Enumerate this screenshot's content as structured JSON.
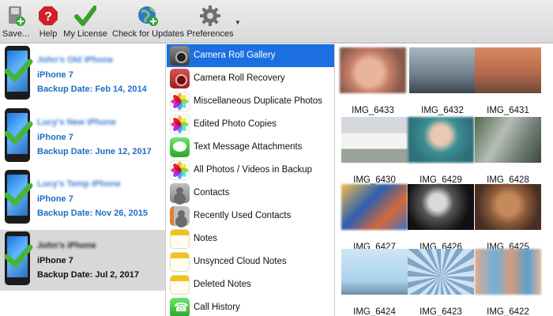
{
  "toolbar": {
    "items": [
      {
        "label": "Save...",
        "icon": "save-icon"
      },
      {
        "label": "Help",
        "icon": "help-icon"
      },
      {
        "label": "My License",
        "icon": "checkmark-icon"
      },
      {
        "label": "Check for Updates",
        "icon": "globe-update-icon"
      },
      {
        "label": "Preferences",
        "icon": "gear-icon"
      }
    ]
  },
  "devices": [
    {
      "name": "John's Old iPhone",
      "model": "iPhone 7",
      "backup": "Backup Date: Feb 14, 2014",
      "selected": false
    },
    {
      "name": "Lucy's New iPhone",
      "model": "iPhone 7",
      "backup": "Backup Date: June 12, 2017",
      "selected": false
    },
    {
      "name": "Lucy's Temp iPhone",
      "model": "iPhone 7",
      "backup": "Backup Date: Nov 26, 2015",
      "selected": false
    },
    {
      "name": "John's iPhone",
      "model": "iPhone 7",
      "backup": "Backup Date: Jul 2, 2017",
      "selected": true
    }
  ],
  "categories": [
    {
      "label": "Camera Roll Gallery",
      "icon": "camera-icon",
      "selected": true
    },
    {
      "label": "Camera Roll Recovery",
      "icon": "camera-red-icon",
      "selected": false
    },
    {
      "label": "Miscellaneous Duplicate Photos",
      "icon": "photos-icon",
      "selected": false
    },
    {
      "label": "Edited Photo Copies",
      "icon": "photos-icon",
      "selected": false
    },
    {
      "label": "Text Message Attachments",
      "icon": "messages-icon",
      "selected": false
    },
    {
      "label": "All Photos / Videos in Backup",
      "icon": "photos-icon",
      "selected": false
    },
    {
      "label": "Contacts",
      "icon": "contacts-icon",
      "selected": false
    },
    {
      "label": "Recently Used Contacts",
      "icon": "recent-contacts-icon",
      "selected": false
    },
    {
      "label": "Notes",
      "icon": "notes-icon",
      "selected": false
    },
    {
      "label": "Unsynced Cloud Notes",
      "icon": "notes-icon",
      "selected": false
    },
    {
      "label": "Deleted Notes",
      "icon": "notes-icon",
      "selected": false
    },
    {
      "label": "Call History",
      "icon": "phone-icon",
      "selected": false
    }
  ],
  "photos": [
    {
      "caption": "IMG_6433"
    },
    {
      "caption": "IMG_6432"
    },
    {
      "caption": "IMG_6431"
    },
    {
      "caption": "IMG_6430"
    },
    {
      "caption": "IMG_6429"
    },
    {
      "caption": "IMG_6428"
    },
    {
      "caption": "IMG_6427"
    },
    {
      "caption": "IMG_6426"
    },
    {
      "caption": "IMG_6425"
    },
    {
      "caption": "IMG_6424"
    },
    {
      "caption": "IMG_6423"
    },
    {
      "caption": "IMG_6422"
    }
  ],
  "colors": {
    "selection_blue": "#1b6fe0",
    "device_text_blue": "#1f6ec5",
    "selected_device_bg": "#d8d8d8"
  }
}
